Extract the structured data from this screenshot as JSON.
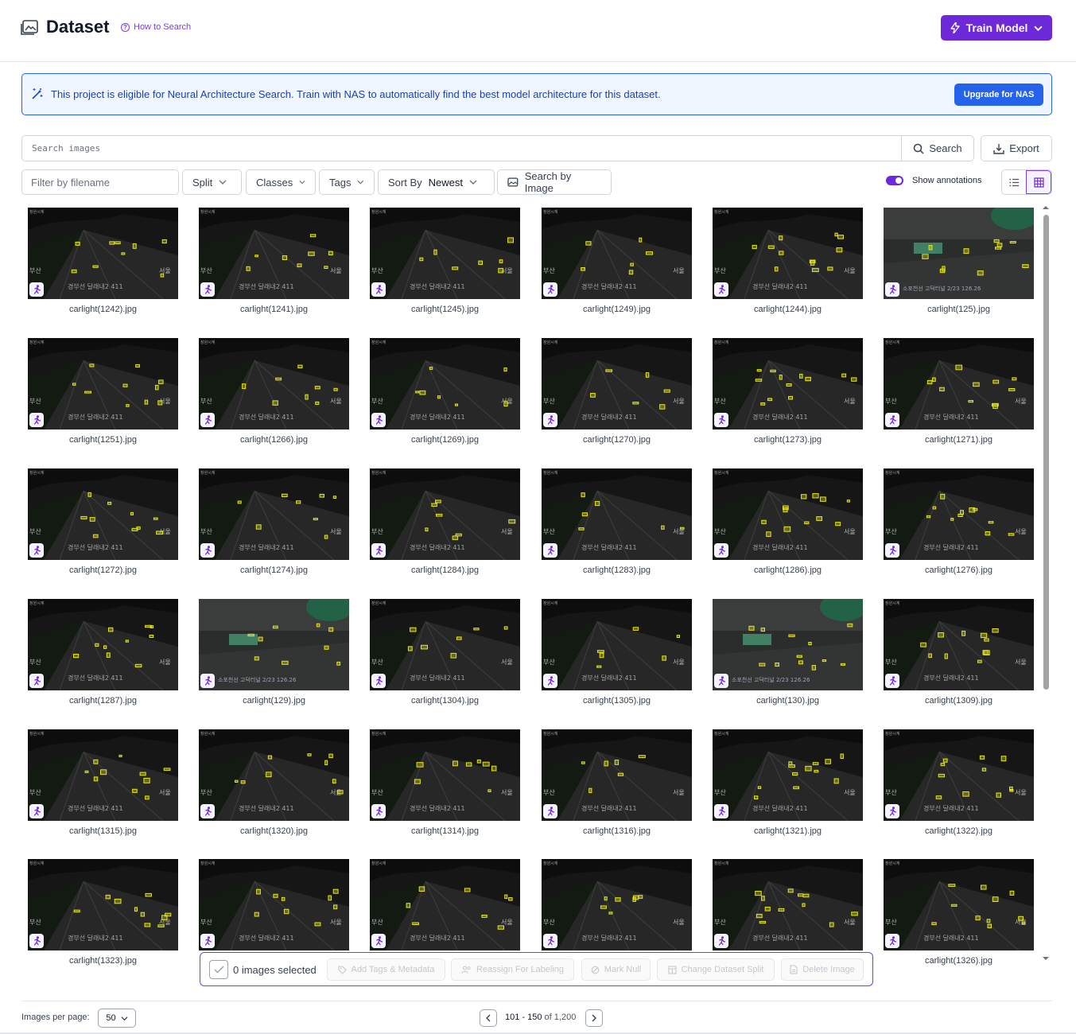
{
  "header": {
    "title": "Dataset",
    "how_to_search": "How to Search",
    "train_button": "Train Model"
  },
  "banner": {
    "text": "This project is eligible for Neural Architecture Search. Train with NAS to automatically find the best model architecture for this dataset.",
    "button": "Upgrade for NAS"
  },
  "search": {
    "placeholder": "Search images",
    "button": "Search",
    "export": "Export"
  },
  "filters": {
    "filename_placeholder": "Filter by filename",
    "split": "Split",
    "classes": "Classes",
    "tags": "Tags",
    "sort_label": "Sort By",
    "sort_value": "Newest",
    "search_by_image": "Search by Image",
    "show_annotations": "Show annotations",
    "show_annotations_on": true
  },
  "images": [
    {
      "file": "carlight(1242).jpg",
      "scene": "road"
    },
    {
      "file": "carlight(1241).jpg",
      "scene": "road"
    },
    {
      "file": "carlight(1245).jpg",
      "scene": "road"
    },
    {
      "file": "carlight(1249).jpg",
      "scene": "road"
    },
    {
      "file": "carlight(1244).jpg",
      "scene": "road"
    },
    {
      "file": "carlight(125).jpg",
      "scene": "tunnel"
    },
    {
      "file": "carlight(1251).jpg",
      "scene": "road"
    },
    {
      "file": "carlight(1266).jpg",
      "scene": "road"
    },
    {
      "file": "carlight(1269).jpg",
      "scene": "road"
    },
    {
      "file": "carlight(1270).jpg",
      "scene": "road"
    },
    {
      "file": "carlight(1273).jpg",
      "scene": "road"
    },
    {
      "file": "carlight(1271).jpg",
      "scene": "road"
    },
    {
      "file": "carlight(1272).jpg",
      "scene": "road"
    },
    {
      "file": "carlight(1274).jpg",
      "scene": "road"
    },
    {
      "file": "carlight(1284).jpg",
      "scene": "road"
    },
    {
      "file": "carlight(1283).jpg",
      "scene": "road"
    },
    {
      "file": "carlight(1286).jpg",
      "scene": "road"
    },
    {
      "file": "carlight(1276).jpg",
      "scene": "road"
    },
    {
      "file": "carlight(1287).jpg",
      "scene": "road"
    },
    {
      "file": "carlight(129).jpg",
      "scene": "tunnel"
    },
    {
      "file": "carlight(1304).jpg",
      "scene": "road"
    },
    {
      "file": "carlight(1305).jpg",
      "scene": "road"
    },
    {
      "file": "carlight(130).jpg",
      "scene": "tunnel"
    },
    {
      "file": "carlight(1309).jpg",
      "scene": "road"
    },
    {
      "file": "carlight(1315).jpg",
      "scene": "road"
    },
    {
      "file": "carlight(1320).jpg",
      "scene": "road"
    },
    {
      "file": "carlight(1314).jpg",
      "scene": "road"
    },
    {
      "file": "carlight(1316).jpg",
      "scene": "road"
    },
    {
      "file": "carlight(1321).jpg",
      "scene": "road"
    },
    {
      "file": "carlight(1322).jpg",
      "scene": "road"
    },
    {
      "file": "carlight(1323).jpg",
      "scene": "road"
    },
    {
      "file": "",
      "scene": "road"
    },
    {
      "file": "",
      "scene": "road"
    },
    {
      "file": "",
      "scene": "road"
    },
    {
      "file": "",
      "scene": "road"
    },
    {
      "file": "carlight(1326).jpg",
      "scene": "road"
    }
  ],
  "overlay_text": {
    "road_left": "부산",
    "road_left2": "경부선 달래내2 411",
    "road_right": "서울",
    "tunnel": "소포천선 고덕터널 2/23 126.26"
  },
  "bulk": {
    "count_label": "0 images selected",
    "add_tags": "Add Tags & Metadata",
    "reassign": "Reassign For Labeling",
    "mark_null": "Mark Null",
    "change_split": "Change Dataset Split",
    "delete": "Delete Image"
  },
  "pagination": {
    "per_page_label": "Images per page:",
    "per_page_value": "50",
    "range": "101 - 150",
    "of_label": "of",
    "total": "1,200"
  },
  "colors": {
    "accent": "#6d28d9",
    "banner_blue": "#2563eb",
    "annotation_box": "#e5e51a"
  }
}
